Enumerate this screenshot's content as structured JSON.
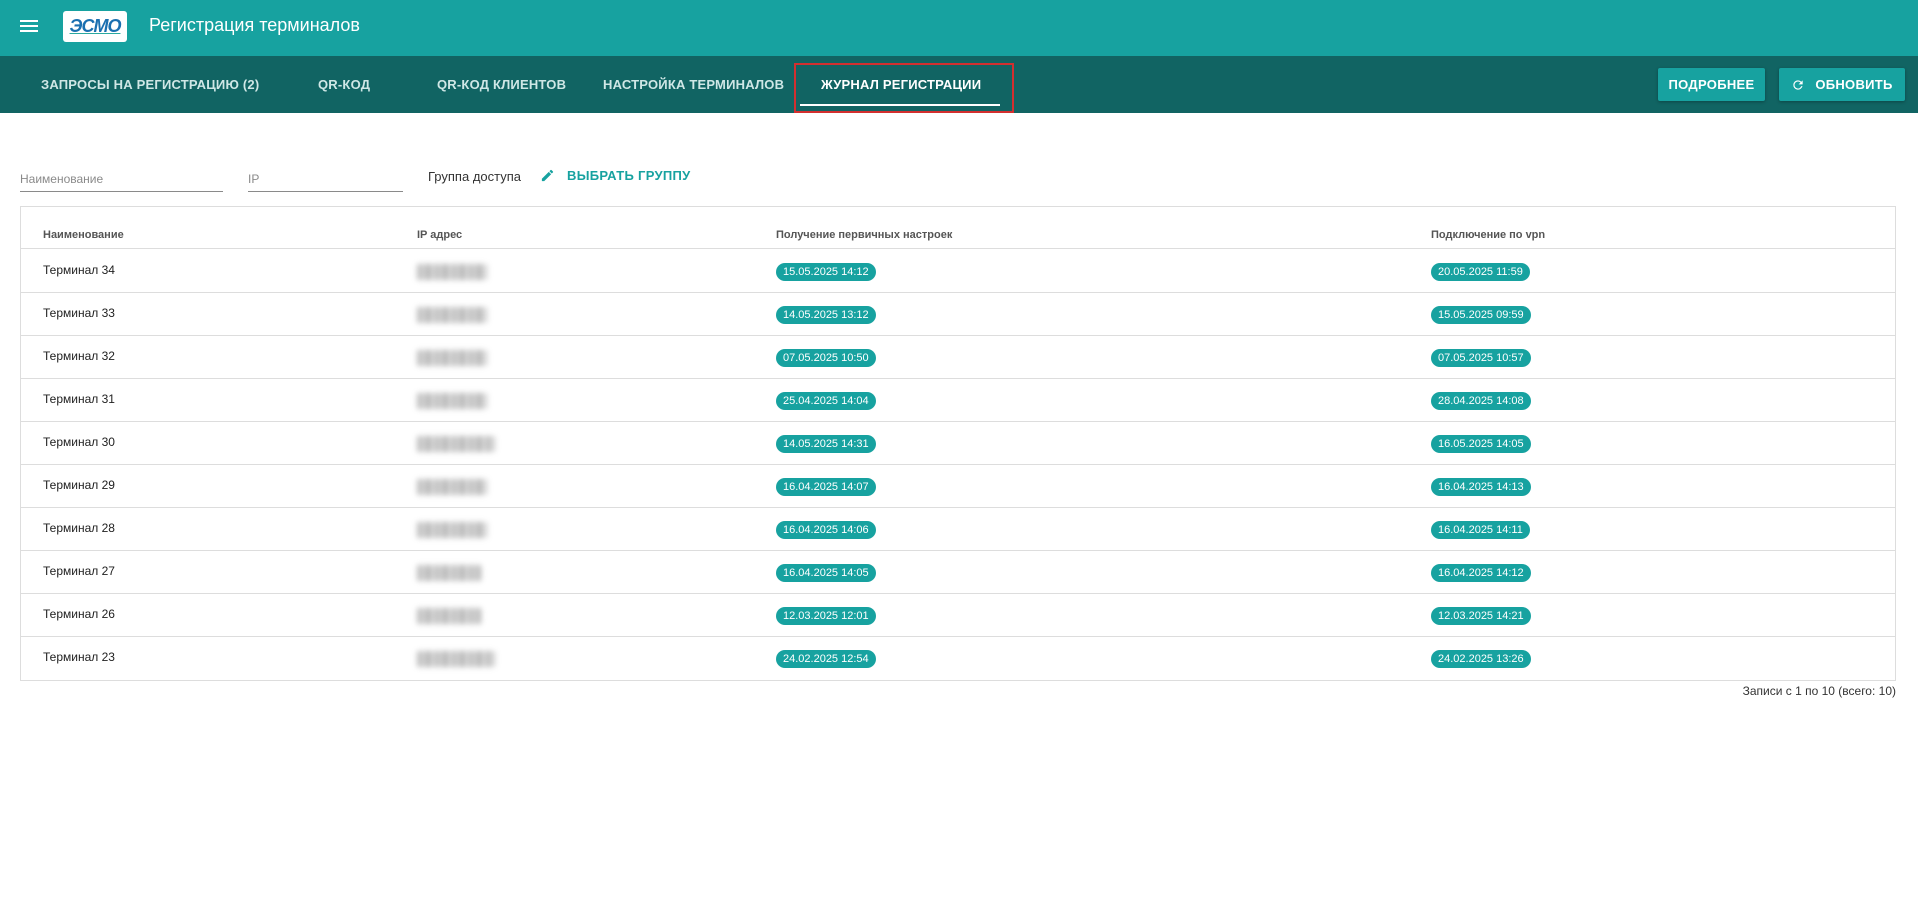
{
  "header": {
    "logo_text": "ЭСМО",
    "title": "Регистрация терминалов"
  },
  "tabs": [
    {
      "label": "ЗАПРОСЫ НА РЕГИСТРАЦИЮ (2)"
    },
    {
      "label": "QR-КОД"
    },
    {
      "label": "QR-КОД КЛИЕНТОВ"
    },
    {
      "label": "НАСТРОЙКА ТЕРМИНАЛОВ"
    },
    {
      "label": "ЖУРНАЛ РЕГИСТРАЦИИ",
      "active": true
    }
  ],
  "actions": {
    "details_label": "ПОДРОБНЕЕ",
    "refresh_label": "ОБНОВИТЬ"
  },
  "filters": {
    "name_placeholder": "Наименование",
    "ip_placeholder": "IP",
    "group_label": "Группа доступа",
    "choose_group_label": "ВЫБРАТЬ ГРУППУ"
  },
  "table": {
    "columns": [
      "Наименование",
      "IP адрес",
      "Получение первичных настроек",
      "Подключение по vpn"
    ],
    "rows": [
      {
        "name": "Терминал 34",
        "ip": "███.██.██.██",
        "settings": "15.05.2025 14:12",
        "vpn": "20.05.2025 11:59"
      },
      {
        "name": "Терминал 33",
        "ip": "███.██.██.██",
        "settings": "14.05.2025 13:12",
        "vpn": "15.05.2025 09:59"
      },
      {
        "name": "Терминал 32",
        "ip": "███.██.██.██",
        "settings": "07.05.2025 10:50",
        "vpn": "07.05.2025 10:57"
      },
      {
        "name": "Терминал 31",
        "ip": "███.██.██.██",
        "settings": "25.04.2025 14:04",
        "vpn": "28.04.2025 14:08"
      },
      {
        "name": "Терминал 30",
        "ip": "███.██.██.██",
        "settings": "14.05.2025 14:31",
        "vpn": "16.05.2025 14:05"
      },
      {
        "name": "Терминал 29",
        "ip": "███.██.██.██",
        "settings": "16.04.2025 14:07",
        "vpn": "16.04.2025 14:13"
      },
      {
        "name": "Терминал 28",
        "ip": "███.██.██.██",
        "settings": "16.04.2025 14:06",
        "vpn": "16.04.2025 14:11"
      },
      {
        "name": "Терминал 27",
        "ip": "███.██.██.██",
        "settings": "16.04.2025 14:05",
        "vpn": "16.04.2025 14:12"
      },
      {
        "name": "Терминал 26",
        "ip": "███.██.██.██",
        "settings": "12.03.2025 12:01",
        "vpn": "12.03.2025 14:21"
      },
      {
        "name": "Терминал 23",
        "ip": "███.██.██.██",
        "settings": "24.02.2025 12:54",
        "vpn": "24.02.2025 13:26"
      }
    ]
  },
  "pagination": {
    "summary": "Записи с 1 по 10 (всего: 10)"
  },
  "icons": {
    "menu": "hamburger-menu-icon",
    "refresh": "refresh-icon",
    "pencil": "pencil-icon"
  },
  "colors": {
    "primary": "#17a2a0",
    "tabbar": "#116463",
    "highlight": "#d32f2f"
  }
}
